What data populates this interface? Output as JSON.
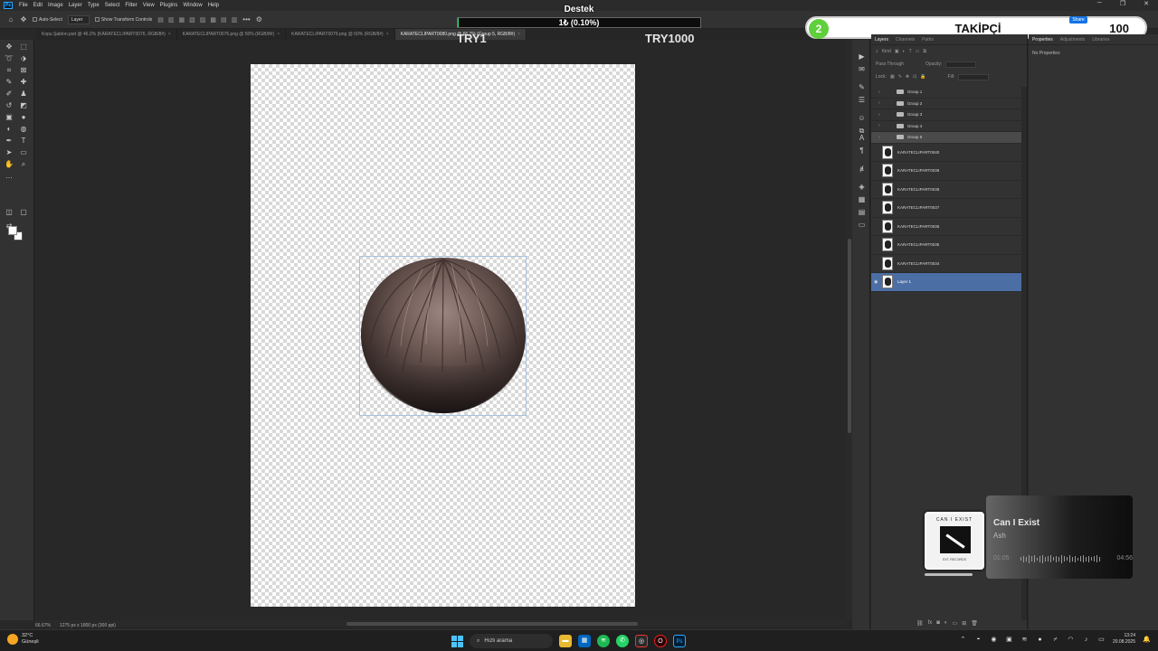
{
  "menu": {
    "items": [
      "File",
      "Edit",
      "Image",
      "Layer",
      "Type",
      "Select",
      "Filter",
      "View",
      "Plugins",
      "Window",
      "Help"
    ],
    "app_logo": "Ps"
  },
  "window_controls": {
    "minimize": "─",
    "maximize": "❐",
    "close": "✕"
  },
  "options_bar": {
    "auto_select_label": "Auto-Select",
    "auto_select_target": "Layer",
    "show_transform_label": "Show Transform Controls",
    "more": "•••"
  },
  "tabs": [
    {
      "label": "Kopu Şablon.psd @ 46.2% (KARATECLIPART0076, RGB/8#)",
      "active": false
    },
    {
      "label": "KARATECLIPART0076.png @ 50% (RGB/8#)",
      "active": false
    },
    {
      "label": "KARATECLIPART0079.png @ 50% (RGB/8#)",
      "active": false
    },
    {
      "label": "KARATECLIPART0080.png @ 66,7% (Group 5, RGB/8#)",
      "active": true
    }
  ],
  "overlay": {
    "title": "Destek",
    "progress_text": "1₺ (0.10%)",
    "progress_value": 0.001,
    "try_left": "TRY1",
    "try_right": "TRY1000",
    "follower_count": "2",
    "follower_label": "TAKİPÇİ",
    "follower_goal": "100",
    "share_label": "Share"
  },
  "layers_panel": {
    "tabs": [
      "Layers",
      "Channels",
      "Paths"
    ],
    "kind_label": "Kind",
    "blend_mode": "Pass Through",
    "opacity_label": "Opacity:",
    "lock_label": "Lock:",
    "fill_label": "Fill:",
    "layers": [
      {
        "name": "Group 1",
        "type": "group",
        "active": false
      },
      {
        "name": "Group 2",
        "type": "group",
        "active": false
      },
      {
        "name": "Group 3",
        "type": "group",
        "active": false
      },
      {
        "name": "Group 4",
        "type": "group",
        "active": false
      },
      {
        "name": "Group 5",
        "type": "group",
        "active": false,
        "highlighted": true
      },
      {
        "name": "KARATECLIPART0040",
        "type": "image",
        "active": false
      },
      {
        "name": "KARATECLIPART0039",
        "type": "image",
        "active": false
      },
      {
        "name": "KARATECLIPART0038",
        "type": "image",
        "active": false
      },
      {
        "name": "KARATECLIPART0037",
        "type": "image",
        "active": false
      },
      {
        "name": "KARATECLIPART0036",
        "type": "image",
        "active": false
      },
      {
        "name": "KARATECLIPART0035",
        "type": "image",
        "active": false
      },
      {
        "name": "KARATECLIPART0034",
        "type": "image",
        "active": false
      },
      {
        "name": "Layer 1",
        "type": "image",
        "active": true
      }
    ]
  },
  "properties_panel": {
    "tabs": [
      "Properties",
      "Adjustments",
      "Libraries"
    ],
    "empty_text": "No Properties"
  },
  "status": {
    "zoom": "66.67%",
    "doc_info": "1275 px x 1800 px (300 ppi)"
  },
  "music": {
    "title": "Can I Exist",
    "artist": "Ash",
    "time_elapsed": "01:05",
    "time_total": "04:56",
    "progress": 0.22,
    "album_text": "CAN I EXIST",
    "album_sub": "EXT. RECORDS"
  },
  "taskbar": {
    "temperature": "32°C",
    "weather": "Güneşli",
    "search_placeholder": "Hızlı arama",
    "time": "13:24",
    "date": "20.08.2025"
  },
  "colors": {
    "accent_blue": "#4b6ea5",
    "overlay_green": "#5fcf3c",
    "ps_blue": "#31a8ff"
  }
}
